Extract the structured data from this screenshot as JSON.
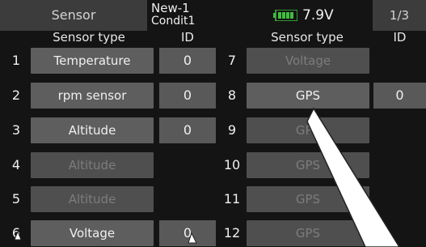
{
  "header": {
    "screen_title": "Sensor",
    "model_line1": "New-1",
    "model_line2": "Condit1",
    "battery_voltage": "7.9V",
    "page_indicator": "1/3"
  },
  "columns": {
    "left_sensor_type": "Sensor type",
    "left_id": "ID",
    "right_sensor_type": "Sensor type",
    "right_id": "ID"
  },
  "left_slots": [
    {
      "num": "1",
      "sensor": "Temperature",
      "id": "0",
      "enabled": true
    },
    {
      "num": "2",
      "sensor": "rpm sensor",
      "id": "0",
      "enabled": true
    },
    {
      "num": "3",
      "sensor": "Altitude",
      "id": "0",
      "enabled": true
    },
    {
      "num": "4",
      "sensor": "Altitude",
      "id": "",
      "enabled": false
    },
    {
      "num": "5",
      "sensor": "Altitude",
      "id": "",
      "enabled": false
    },
    {
      "num": "6",
      "sensor": "Voltage",
      "id": "0",
      "enabled": true
    }
  ],
  "right_slots": [
    {
      "num": "7",
      "sensor": "Voltage",
      "id": "",
      "enabled": false
    },
    {
      "num": "8",
      "sensor": "GPS",
      "id": "0",
      "enabled": true
    },
    {
      "num": "9",
      "sensor": "GPS",
      "id": "",
      "enabled": false
    },
    {
      "num": "10",
      "sensor": "GPS",
      "id": "",
      "enabled": false
    },
    {
      "num": "11",
      "sensor": "GPS",
      "id": "",
      "enabled": false
    },
    {
      "num": "12",
      "sensor": "GPS",
      "id": "",
      "enabled": false
    }
  ],
  "icons": {
    "battery": "battery-icon"
  },
  "colors": {
    "background": "#141414",
    "button": "#5e5e5e",
    "battery_green": "#3fbf3f"
  }
}
